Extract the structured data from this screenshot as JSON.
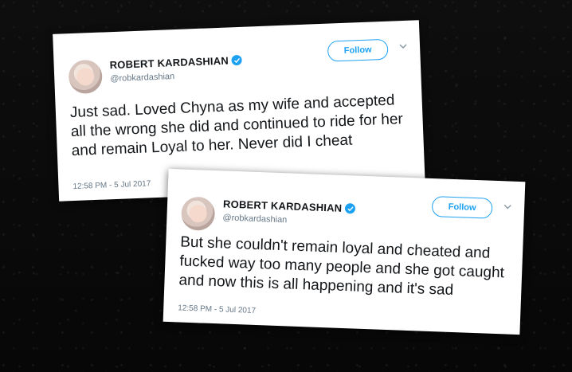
{
  "tweets": [
    {
      "author_name": "ROBERT KARDASHIAN",
      "handle": "@robkardashian",
      "follow_label": "Follow",
      "text": "Just sad. Loved Chyna as my wife and accepted all the wrong she did and continued to ride for her and remain Loyal to her. Never did I cheat",
      "timestamp": "12:58 PM - 5 Jul 2017"
    },
    {
      "author_name": "ROBERT KARDASHIAN",
      "handle": "@robkardashian",
      "follow_label": "Follow",
      "text": "But she couldn't remain loyal and cheated and fucked way too many people and she got caught and now this is all happening and it's sad",
      "timestamp": "12:58 PM - 5 Jul 2017"
    }
  ],
  "colors": {
    "accent": "#1da1f2",
    "text": "#14171a",
    "muted": "#657786",
    "background": "#0b0b0b"
  },
  "icons": [
    "verified-badge-icon",
    "chevron-down-icon",
    "avatar-photo"
  ]
}
